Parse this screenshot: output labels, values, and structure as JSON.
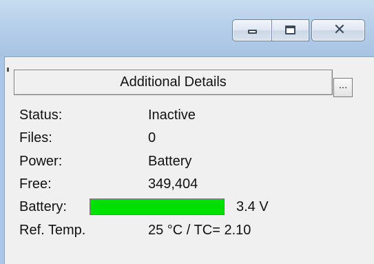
{
  "window": {
    "caption_buttons": {
      "minimize_icon": "minimize-icon",
      "maximize_icon": "maximize-icon",
      "close_icon": "close-icon"
    }
  },
  "details": {
    "header": "Additional Details",
    "more_button_label": "...",
    "rows": [
      {
        "label": "Status:",
        "value": "Inactive"
      },
      {
        "label": "Files:",
        "value": "0"
      },
      {
        "label": "Power:",
        "value": "Battery"
      },
      {
        "label": "Free:",
        "value": "349,404"
      }
    ],
    "battery": {
      "label": "Battery:",
      "level_fraction": 1.0,
      "level_color": "#00e000",
      "voltage": "3.4 V"
    },
    "ref_temp": {
      "label": "Ref. Temp.",
      "value": "25 °C / TC= 2.10"
    }
  }
}
